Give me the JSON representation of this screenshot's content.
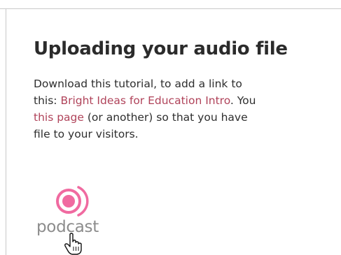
{
  "heading": "Uploading your audio file",
  "paragraph": {
    "line1": "Download this tutorial, to add a link to",
    "line2_before": "this: ",
    "line2_link": "Bright Ideas for Education Intro",
    "line2_after": ". You",
    "line3_link": "this page",
    "line3_after": " (or another) so that you have",
    "line4": "file to your visitors."
  },
  "podcast_badge": {
    "label": "podcast",
    "icon": "podcast-broadcast-icon",
    "color": "#f06aa0"
  },
  "cursor": {
    "icon": "hand-pointer-icon"
  },
  "colors": {
    "link": "#b0435a",
    "heading": "#2b2b2b",
    "body_text": "#2e2e2e",
    "border": "#c9c9c9"
  }
}
